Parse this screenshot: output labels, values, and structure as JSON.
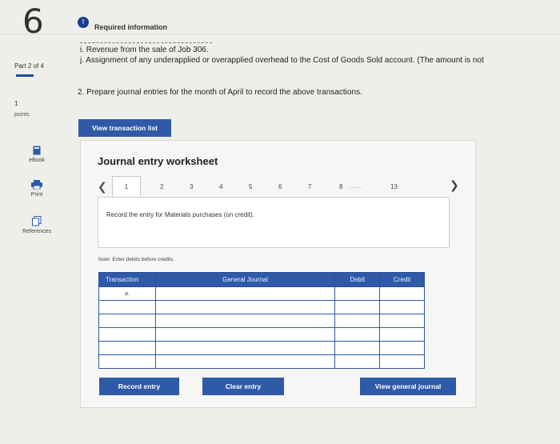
{
  "question": {
    "number": "6",
    "part": "Part 2 of 4",
    "points_value": "1",
    "points_label": "points"
  },
  "sidebar": {
    "items": [
      {
        "label": "eBook",
        "icon": "book-icon"
      },
      {
        "label": "Print",
        "icon": "printer-icon"
      },
      {
        "label": "References",
        "icon": "references-icon"
      }
    ]
  },
  "header": {
    "info_badge": "!",
    "required_info": "Required information"
  },
  "prompt": {
    "line_i": "i. Revenue from the sale of Job 306.",
    "line_j": "j. Assignment of any underapplied or overapplied overhead to the Cost of Goods Sold account. (The amount is not",
    "line_2": "2. Prepare journal entries for the month of April to record the above transactions."
  },
  "buttons": {
    "view_transaction_list": "View transaction list",
    "record_entry": "Record entry",
    "clear_entry": "Clear entry",
    "view_general_journal": "View general journal"
  },
  "worksheet": {
    "title": "Journal entry worksheet",
    "tabs": [
      "1",
      "2",
      "3",
      "4",
      "5",
      "6",
      "7",
      "8"
    ],
    "tab_dots": ".....",
    "tab_last": "13",
    "active_tab": "1",
    "description": "Record the entry for Materials purchases (on credit).",
    "note": "Note: Enter debits before credits."
  },
  "table": {
    "headers": {
      "transaction": "Transaction",
      "general_journal": "General Journal",
      "debit": "Debit",
      "credit": "Credit"
    },
    "rows": [
      {
        "transaction": "a."
      },
      {
        "transaction": ""
      },
      {
        "transaction": ""
      },
      {
        "transaction": ""
      },
      {
        "transaction": ""
      },
      {
        "transaction": ""
      }
    ]
  },
  "colors": {
    "accent": "#2f5aa8",
    "info_dot": "#1c3f8f",
    "background": "#eeeeeb"
  }
}
